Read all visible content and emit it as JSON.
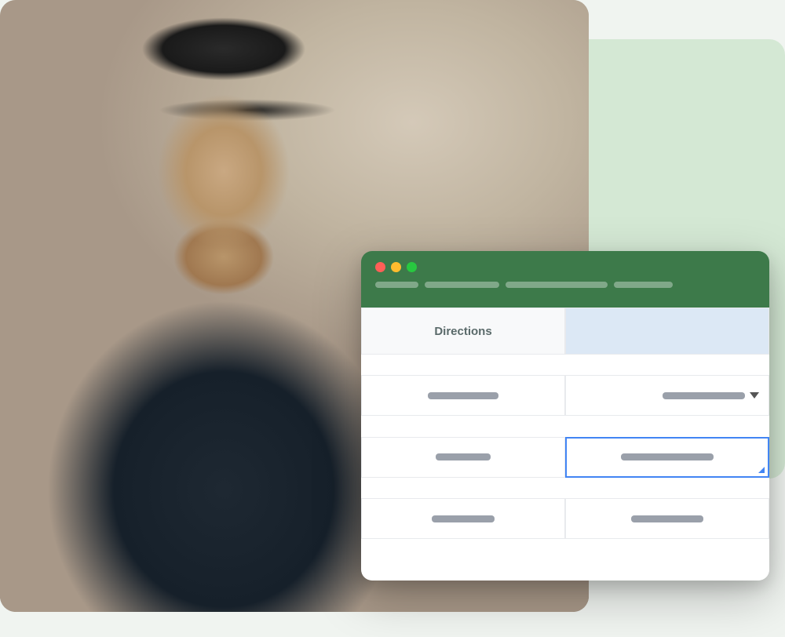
{
  "scene": {
    "photo_alt": "Delivery person holding a package"
  },
  "browser": {
    "titlebar": {
      "traffic_lights": [
        {
          "color": "red",
          "label": "close"
        },
        {
          "color": "yellow",
          "label": "minimize"
        },
        {
          "color": "green",
          "label": "maximize"
        }
      ],
      "url_segments": [
        {
          "width": 60
        },
        {
          "width": 100
        },
        {
          "width": 140
        },
        {
          "width": 80
        }
      ]
    },
    "spreadsheet": {
      "header_left": "Directions",
      "header_right": "",
      "rows": [
        {
          "left_bar_width": 90,
          "right_bar_width": 110,
          "right_has_dropdown": true
        },
        {
          "left_bar_width": 70,
          "right_has_input": true,
          "right_bar_width": 120
        },
        {
          "left_bar_width": 80,
          "right_bar_width": 95
        }
      ]
    }
  }
}
